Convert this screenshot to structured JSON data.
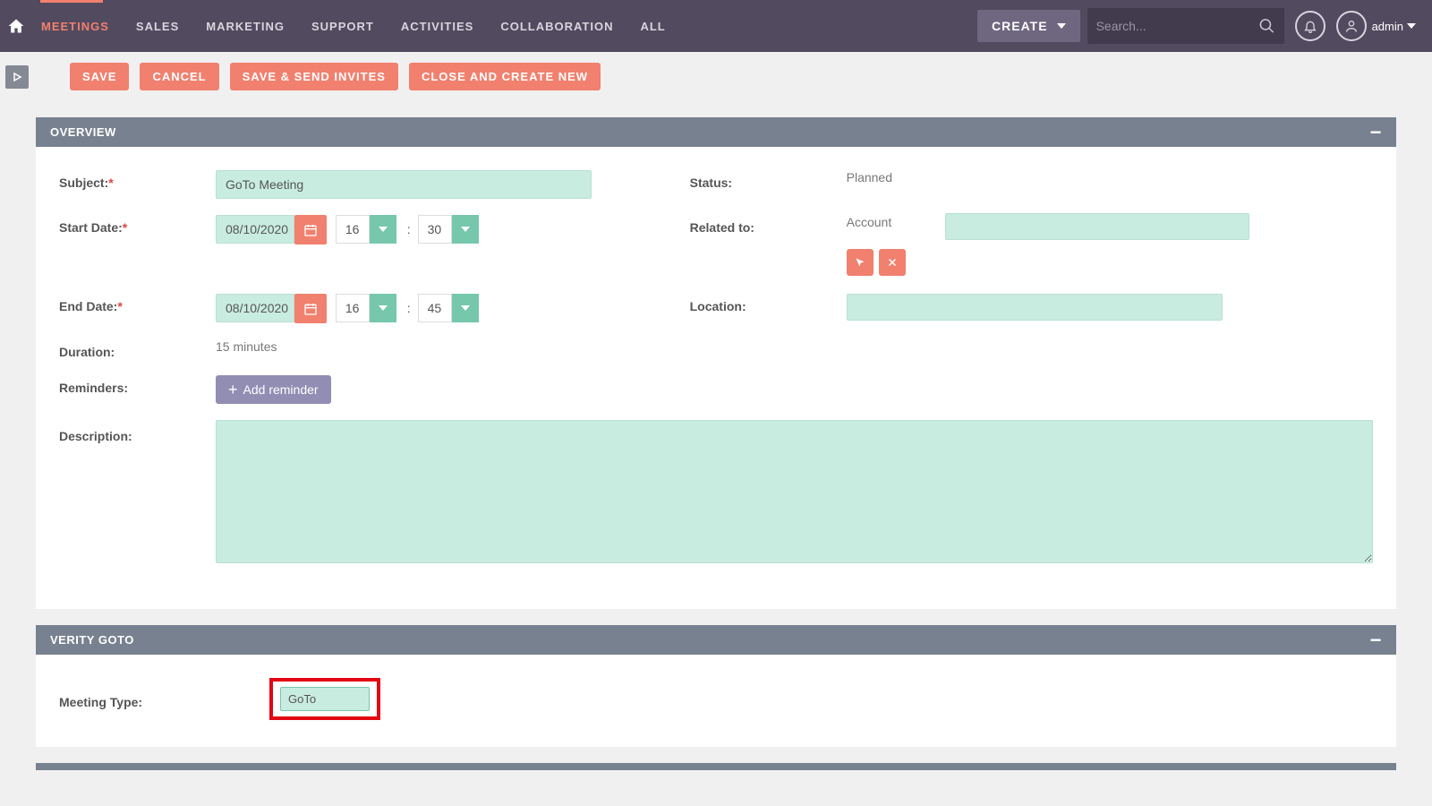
{
  "topnav": {
    "items": [
      "MEETINGS",
      "SALES",
      "MARKETING",
      "SUPPORT",
      "ACTIVITIES",
      "COLLABORATION",
      "ALL"
    ],
    "active_index": 0,
    "create_label": "CREATE",
    "search_placeholder": "Search...",
    "user_label": "admin"
  },
  "actions": {
    "save": "SAVE",
    "cancel": "CANCEL",
    "save_send": "SAVE & SEND INVITES",
    "close_new": "CLOSE AND CREATE NEW"
  },
  "panels": {
    "overview": {
      "title": "OVERVIEW",
      "labels": {
        "subject": "Subject:",
        "start_date": "Start Date:",
        "end_date": "End Date:",
        "duration": "Duration:",
        "reminders": "Reminders:",
        "description": "Description:",
        "status": "Status:",
        "related_to": "Related to:",
        "location": "Location:"
      },
      "values": {
        "subject": "GoTo Meeting",
        "start_date": "08/10/2020",
        "start_hour": "16",
        "start_min": "30",
        "end_date": "08/10/2020",
        "end_hour": "16",
        "end_min": "45",
        "duration": "15 minutes",
        "status": "Planned",
        "related_type": "Account",
        "add_reminder_label": "Add reminder"
      }
    },
    "verity": {
      "title": "VERITY GOTO",
      "labels": {
        "meeting_type": "Meeting Type:"
      },
      "values": {
        "meeting_type": "GoTo"
      }
    }
  }
}
